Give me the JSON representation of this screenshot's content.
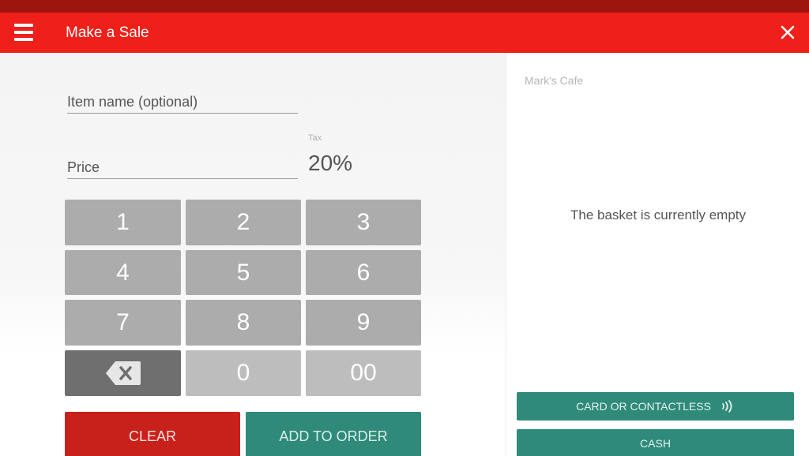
{
  "appbar": {
    "title": "Make a Sale",
    "menu_icon": "hamburger-menu-icon",
    "close_icon": "close-icon"
  },
  "form": {
    "item_name_placeholder": "Item name (optional)",
    "item_name_value": "",
    "price_placeholder": "Price",
    "price_value": "",
    "tax_label": "Tax",
    "tax_value": "20%"
  },
  "keypad": {
    "keys": [
      "1",
      "2",
      "3",
      "4",
      "5",
      "6",
      "7",
      "8",
      "9"
    ],
    "backspace_icon": "backspace-icon",
    "zero": "0",
    "double_zero": "00"
  },
  "actions": {
    "clear_label": "CLEAR",
    "add_label": "ADD TO ORDER"
  },
  "basket": {
    "shop_name": "Mark's Cafe",
    "empty_message": "The basket is currently empty",
    "card_label": "CARD OR CONTACTLESS",
    "contactless_icon": "contactless-icon",
    "cash_label": "CASH"
  },
  "colors": {
    "primary_red": "#ef1f1a",
    "status_red": "#9e150e",
    "teal": "#2f8a7a",
    "clear_red": "#c8201a",
    "key_gray": "#acacac"
  }
}
